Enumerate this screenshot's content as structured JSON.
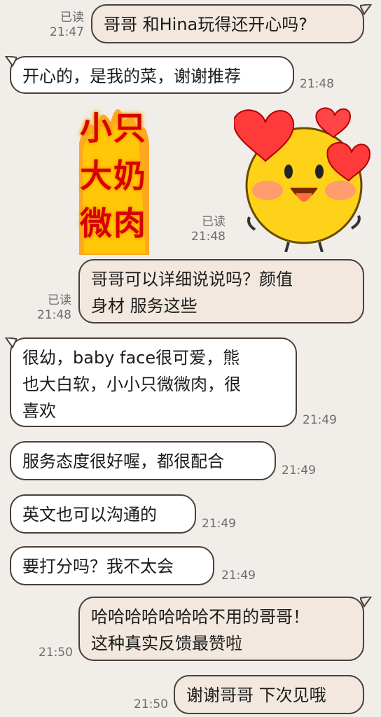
{
  "conversation": {
    "m1": {
      "text": "哥哥 和Hina玩得还开心吗?",
      "status": "已读",
      "time": "21:47"
    },
    "m2": {
      "text": "开心的，是我的菜，谢谢推荐",
      "time": "21:48"
    },
    "sticker1": {
      "lines": [
        "小只",
        "大奶",
        "微肉"
      ]
    },
    "sticker2": {
      "status": "已读",
      "time": "21:48"
    },
    "m3": {
      "text": "哥哥可以详细说说吗？颜值\n身材 服务这些",
      "status": "已读",
      "time": "21:48"
    },
    "m4": {
      "text": "很幼，baby face很可爱，熊\n也大白软，小小只微微肉，很\n喜欢",
      "time": "21:49"
    },
    "m5": {
      "text": "服务态度很好喔，都很配合",
      "time": "21:49"
    },
    "m6": {
      "text": "英文也可以沟通的",
      "time": "21:49"
    },
    "m7": {
      "text": "要打分吗？我不太会",
      "time": "21:49"
    },
    "m8": {
      "text": "哈哈哈哈哈哈哈不用的哥哥！\n这种真实反馈最赞啦",
      "time": "21:50"
    },
    "m9": {
      "text": "谢谢哥哥 下次见哦",
      "time": "21:50"
    }
  },
  "colors": {
    "background": "#f1ede8",
    "incoming": "#ffffff",
    "outgoing": "#f2e8df",
    "border": "#4a3f39"
  },
  "icons": {
    "sticker1": "fire-text-sticker",
    "sticker2": "heart-eyes-emoji"
  }
}
